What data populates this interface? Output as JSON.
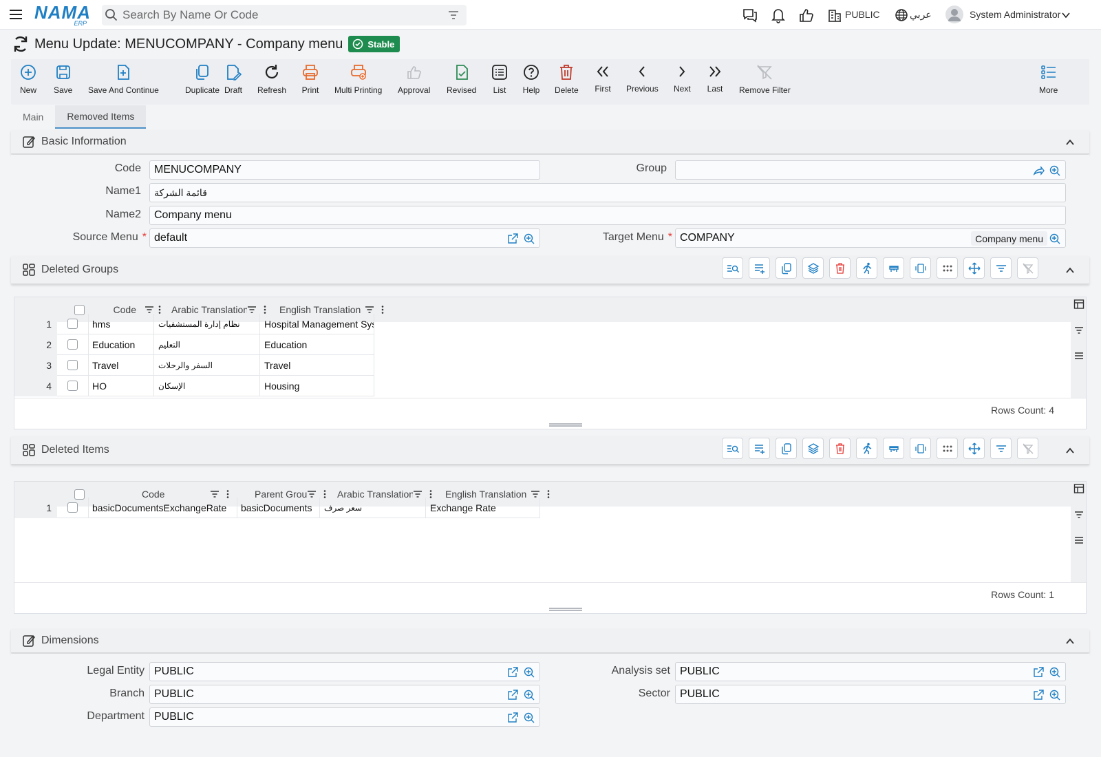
{
  "topbar": {
    "logo_main": "NAMA",
    "logo_sub": "ERP",
    "search_placeholder": "Search By Name Or Code",
    "company": "PUBLIC",
    "language": "عربي",
    "user": "System Administrator"
  },
  "header": {
    "title": "Menu Update: MENUCOMPANY - Company menu",
    "status": "Stable"
  },
  "toolbar": [
    {
      "label": "New",
      "icon": "plus-circle-icon"
    },
    {
      "label": "Save",
      "icon": "save-icon"
    },
    {
      "label": "Save And Continue",
      "icon": "save-continue-icon"
    },
    {
      "label": "Duplicate",
      "icon": "duplicate-icon"
    },
    {
      "label": "Draft",
      "icon": "draft-icon"
    },
    {
      "label": "Refresh",
      "icon": "refresh-icon"
    },
    {
      "label": "Print",
      "icon": "print-icon"
    },
    {
      "label": "Multi Printing",
      "icon": "multi-print-icon"
    },
    {
      "label": "Approval",
      "icon": "thumbs-up-icon"
    },
    {
      "label": "Revised",
      "icon": "revised-icon"
    },
    {
      "label": "List",
      "icon": "list-icon"
    },
    {
      "label": "Help",
      "icon": "help-icon"
    },
    {
      "label": "Delete",
      "icon": "trash-icon"
    },
    {
      "label": "First",
      "icon": "first-icon"
    },
    {
      "label": "Previous",
      "icon": "previous-icon"
    },
    {
      "label": "Next",
      "icon": "next-icon"
    },
    {
      "label": "Last",
      "icon": "last-icon"
    },
    {
      "label": "Remove Filter",
      "icon": "remove-filter-icon"
    },
    {
      "label": "More",
      "icon": "more-icon"
    }
  ],
  "tabs": [
    {
      "label": "Main",
      "active": false
    },
    {
      "label": "Removed Items",
      "active": true
    }
  ],
  "basic_info": {
    "title": "Basic Information",
    "code_label": "Code",
    "code_value": "MENUCOMPANY",
    "group_label": "Group",
    "group_value": "",
    "name1_label": "Name1",
    "name1_value": "قائمة الشركة",
    "name2_label": "Name2",
    "name2_value": "Company menu",
    "source_label": "Source Menu",
    "source_value": "default",
    "target_label": "Target Menu",
    "target_value": "COMPANY",
    "target_chip": "Company menu"
  },
  "deleted_groups": {
    "title": "Deleted Groups",
    "columns": [
      "Code",
      "Arabic Translation",
      "English Translation"
    ],
    "rows": [
      {
        "num": "1",
        "code": "hms",
        "ar": "نظام إدارة المستشفيات",
        "en": "Hospital Management System"
      },
      {
        "num": "2",
        "code": "Education",
        "ar": "التعليم",
        "en": "Education"
      },
      {
        "num": "3",
        "code": "Travel",
        "ar": "السفر والرحلات",
        "en": "Travel"
      },
      {
        "num": "4",
        "code": "HO",
        "ar": "الإسكان",
        "en": "Housing"
      }
    ],
    "rows_count": "Rows Count: 4"
  },
  "deleted_items": {
    "title": "Deleted Items",
    "columns": [
      "Code",
      "Parent Group",
      "Arabic Translation",
      "English Translation"
    ],
    "rows": [
      {
        "num": "1",
        "code": "basicDocumentsExchangeRate",
        "parent": "basicDocuments",
        "ar": "سعر صرف",
        "en": "Exchange Rate"
      }
    ],
    "rows_count": "Rows Count: 1"
  },
  "dimensions": {
    "title": "Dimensions",
    "legal_entity_label": "Legal Entity",
    "legal_entity_value": "PUBLIC",
    "branch_label": "Branch",
    "branch_value": "PUBLIC",
    "department_label": "Department",
    "department_value": "PUBLIC",
    "analysis_label": "Analysis set",
    "analysis_value": "PUBLIC",
    "sector_label": "Sector",
    "sector_value": "PUBLIC"
  },
  "colors": {
    "accent": "#1f7fc4",
    "stable_badge": "#1e8c4e",
    "delete_red": "#c0392b",
    "print_orange": "#e8692c",
    "revised_green": "#2e8b57"
  }
}
